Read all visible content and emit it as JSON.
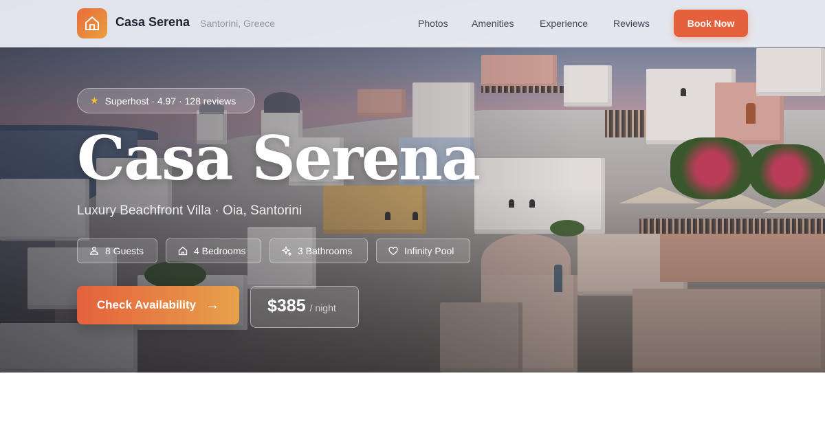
{
  "nav": {
    "brand": "Casa Serena",
    "location": "Santorini, Greece",
    "links": [
      "Photos",
      "Amenities",
      "Experience",
      "Reviews"
    ],
    "book_label": "Book Now"
  },
  "hero": {
    "badge": "Superhost · 4.97 · 128 reviews",
    "title": "Casa Serena",
    "subtitle": "Luxury Beachfront Villa · Oia, Santorini",
    "features": [
      {
        "label": "8 Guests",
        "icon": "guests-icon"
      },
      {
        "label": "4 Bedrooms",
        "icon": "house-icon"
      },
      {
        "label": "3 Bathrooms",
        "icon": "sparkle-icon"
      },
      {
        "label": "Infinity Pool",
        "icon": "heart-icon"
      }
    ],
    "cta_label": "Check Availability",
    "price": "$385",
    "price_unit": "/ night"
  },
  "colors": {
    "accent": "#e5613d",
    "accent_gradient_end": "#e7a14a",
    "star": "#f4c232"
  }
}
